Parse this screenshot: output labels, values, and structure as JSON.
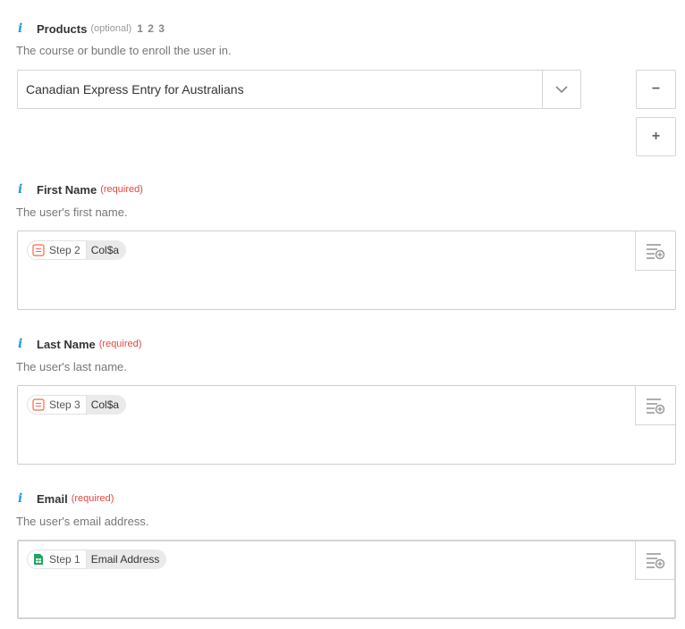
{
  "products": {
    "label": "Products",
    "optional": "(optional)",
    "numbers": "1 2 3",
    "description": "The course or bundle to enroll the user in.",
    "selected": "Canadian Express Entry for Australians",
    "remove_label": "−",
    "add_label": "+"
  },
  "first_name": {
    "label": "First Name",
    "required": "(required)",
    "description": "The user's first name.",
    "pill_step": "Step 2",
    "pill_value": "Col$a"
  },
  "last_name": {
    "label": "Last Name",
    "required": "(required)",
    "description": "The user's last name.",
    "pill_step": "Step 3",
    "pill_value": "Col$a"
  },
  "email": {
    "label": "Email",
    "required": "(required)",
    "description": "The user's email address.",
    "pill_step": "Step 1",
    "pill_value": "Email Address"
  },
  "icons": {
    "info": "info-icon",
    "chevron": "chevron-down-icon",
    "insert": "insert-field-icon",
    "formatter": "formatter-app-icon",
    "sheets": "google-sheets-icon"
  },
  "colors": {
    "info": "#2c9bd6",
    "required": "#e8463a",
    "formatter": "#f26b4a",
    "sheets": "#21a464"
  }
}
